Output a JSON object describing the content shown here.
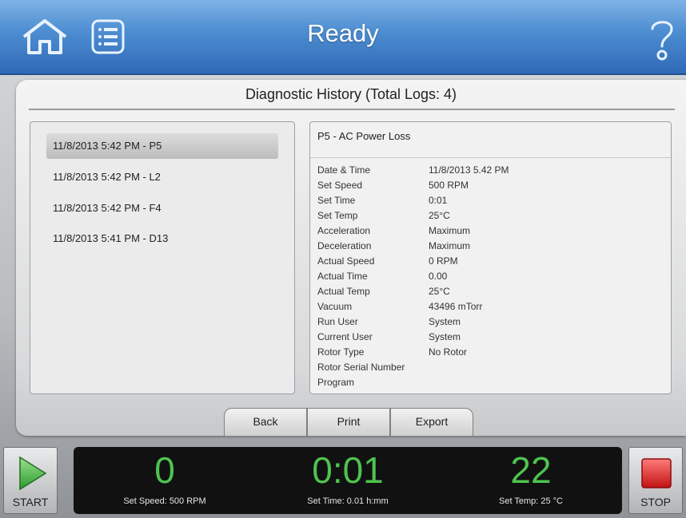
{
  "header": {
    "title": "Ready",
    "home_icon": "home-icon",
    "menu_icon": "list-icon",
    "help_icon": "question-mark-icon",
    "background": "#4f8fd2"
  },
  "history": {
    "title": "Diagnostic History (Total Logs: 4)",
    "logs": [
      {
        "label": "11/8/2013 5:42 PM - P5",
        "selected": true
      },
      {
        "label": "11/8/2013 5:42 PM - L2",
        "selected": false
      },
      {
        "label": "11/8/2013 5:42 PM - F4",
        "selected": false
      },
      {
        "label": "11/8/2013 5:41 PM - D13",
        "selected": false
      }
    ],
    "detail": {
      "heading": "P5 - AC Power Loss",
      "rows": [
        {
          "label": "Date & Time",
          "value": "11/8/2013 5.42 PM"
        },
        {
          "label": "Set Speed",
          "value": "500 RPM"
        },
        {
          "label": "Set Time",
          "value": "0:01"
        },
        {
          "label": "Set Temp",
          "value": "25°C"
        },
        {
          "label": "Acceleration",
          "value": "Maximum"
        },
        {
          "label": "Deceleration",
          "value": "Maximum"
        },
        {
          "label": "Actual Speed",
          "value": "0 RPM"
        },
        {
          "label": "Actual Time",
          "value": "0.00"
        },
        {
          "label": "Actual Temp",
          "value": "25°C"
        },
        {
          "label": "Vacuum",
          "value": "43496 mTorr"
        },
        {
          "label": "Run User",
          "value": "System"
        },
        {
          "label": "Current User",
          "value": "System"
        },
        {
          "label": "Rotor Type",
          "value": "No Rotor"
        },
        {
          "label": "Rotor Serial Number",
          "value": ""
        },
        {
          "label": "Program",
          "value": ""
        }
      ]
    },
    "buttons": {
      "back": "Back",
      "print": "Print",
      "export": "Export"
    }
  },
  "footer": {
    "start_label": "START",
    "start_icon": "play-triangle-icon",
    "stop_label": "STOP",
    "stop_icon": "stop-square-icon",
    "speed": {
      "value": "0",
      "caption": "Set Speed: 500 RPM"
    },
    "time": {
      "value": "0:01",
      "caption": "Set Time: 0.01 h:mm"
    },
    "temp": {
      "value": "22",
      "caption": "Set Temp: 25 °C"
    },
    "accent_green": "#4fc34f",
    "stop_red": "#e02020"
  }
}
